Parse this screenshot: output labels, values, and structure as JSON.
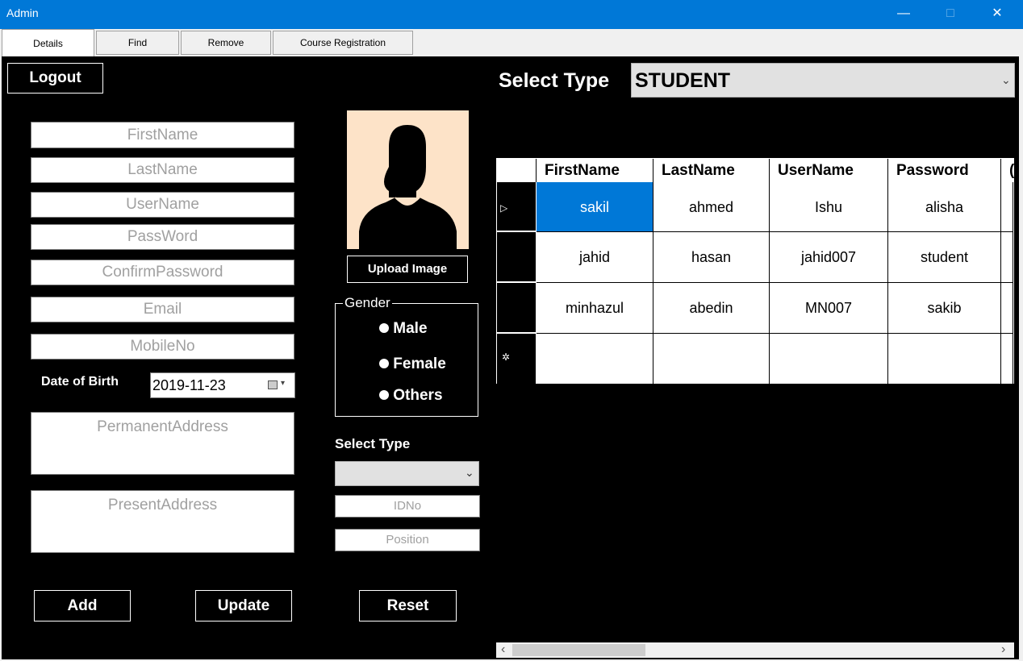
{
  "window": {
    "title": "Admin",
    "minimize": "—",
    "maximize": "□",
    "close": "✕"
  },
  "tabs": [
    "Details",
    "Find",
    "Remove",
    "Course Registration"
  ],
  "buttons": {
    "logout": "Logout",
    "upload_image": "Upload Image",
    "add": "Add",
    "update": "Update",
    "reset": "Reset"
  },
  "form": {
    "firstname_ph": "FirstName",
    "lastname_ph": "LastName",
    "username_ph": "UserName",
    "password_ph": "PassWord",
    "confirm_ph": "ConfirmPassword",
    "email_ph": "Email",
    "mobile_ph": "MobileNo",
    "dob_label": "Date of Birth",
    "dob_value": "2019-11-23",
    "permanent_ph": "PermanentAddress",
    "present_ph": "PresentAddress"
  },
  "gender": {
    "legend": "Gender",
    "options": [
      "Male",
      "Female",
      "Others"
    ]
  },
  "select_type_small": {
    "label": "Select Type",
    "value": "",
    "idno_ph": "IDNo",
    "position_ph": "Position"
  },
  "select_type_big": {
    "label": "Select Type",
    "value": "STUDENT"
  },
  "grid": {
    "columns": [
      "FirstName",
      "LastName",
      "UserName",
      "Password",
      "("
    ],
    "rows": [
      [
        "sakil",
        "ahmed",
        "Ishu",
        "alisha"
      ],
      [
        "jahid",
        "hasan",
        "jahid007",
        "student"
      ],
      [
        "minhazul",
        "abedin",
        "MN007",
        "sakib"
      ]
    ],
    "row_markers": [
      "▷",
      "",
      "",
      "✲"
    ]
  },
  "scroll": {
    "left": "‹",
    "right": "›"
  },
  "colors": {
    "titlebar": "#0078d7",
    "panel": "#000000",
    "selection": "#0078d7",
    "avatar_bg": "#fde3c8"
  }
}
